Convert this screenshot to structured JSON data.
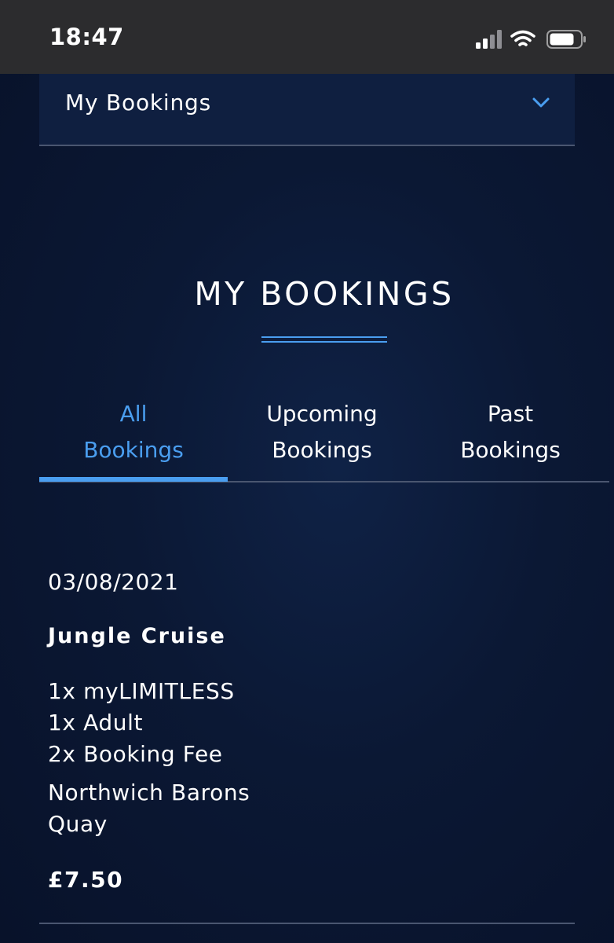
{
  "status_bar": {
    "time": "18:47"
  },
  "dropdown": {
    "label": "My Bookings",
    "icon": "chevron-down-icon"
  },
  "page": {
    "title": "MY BOOKINGS"
  },
  "tabs": [
    {
      "line1": "All",
      "line2": "Bookings",
      "active": true
    },
    {
      "line1": "Upcoming",
      "line2": "Bookings",
      "active": false
    },
    {
      "line1": "Past",
      "line2": "Bookings",
      "active": false
    }
  ],
  "booking": {
    "date": "03/08/2021",
    "name": "Jungle Cruise",
    "items": [
      "1x myLIMITLESS",
      "1x Adult",
      "2x Booking Fee"
    ],
    "location": [
      "Northwich Barons",
      "Quay"
    ],
    "price": "£7.50"
  },
  "colors": {
    "accent": "#4a9ef0",
    "background": "#0a1630",
    "divider": "#4a5670",
    "status_bar": "#2c2c2e"
  }
}
